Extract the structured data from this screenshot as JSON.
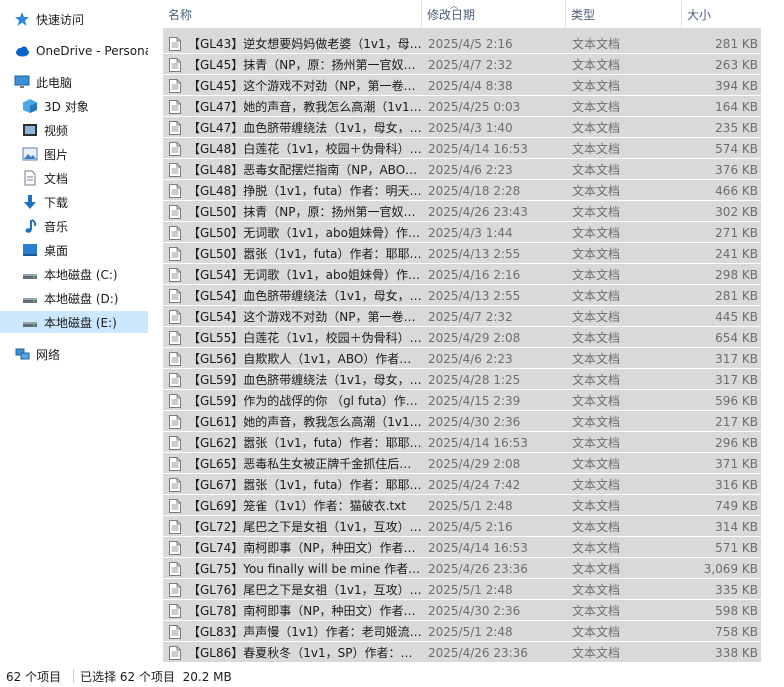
{
  "navigation": [
    {
      "label": "快速访问",
      "icon": "star-icon"
    },
    {
      "label": "OneDrive - Persona",
      "icon": "cloud-icon"
    },
    {
      "label": "此电脑",
      "icon": "computer-icon"
    },
    {
      "label": "3D 对象",
      "icon": "cube-icon"
    },
    {
      "label": "视频",
      "icon": "video-icon"
    },
    {
      "label": "图片",
      "icon": "picture-icon"
    },
    {
      "label": "文档",
      "icon": "document-icon"
    },
    {
      "label": "下载",
      "icon": "download-icon"
    },
    {
      "label": "音乐",
      "icon": "music-icon"
    },
    {
      "label": "桌面",
      "icon": "desktop-icon"
    },
    {
      "label": "本地磁盘 (C:)",
      "icon": "drive-icon"
    },
    {
      "label": "本地磁盘 (D:)",
      "icon": "drive-icon"
    },
    {
      "label": "本地磁盘 (E:)",
      "icon": "drive-icon",
      "selected": true
    },
    {
      "label": "网络",
      "icon": "network-icon"
    }
  ],
  "columns": {
    "name": "名称",
    "date": "修改日期",
    "type": "类型",
    "size": "大小"
  },
  "files": [
    {
      "name": "【GL43】逆女想要妈妈做老婆（1v1，母…",
      "date": "2025/4/5 2:16",
      "type": "文本文档",
      "size": "281 KB"
    },
    {
      "name": "【GL45】抹青（NP，原：扬州第一官奴…",
      "date": "2025/4/7 2:32",
      "type": "文本文档",
      "size": "263 KB"
    },
    {
      "name": "【GL45】这个游戏不对劲（NP，第一卷…",
      "date": "2025/4/4 8:38",
      "type": "文本文档",
      "size": "394 KB"
    },
    {
      "name": "【GL47】她的声音，教我怎么高潮（1v1…",
      "date": "2025/4/25 0:03",
      "type": "文本文档",
      "size": "164 KB"
    },
    {
      "name": "【GL47】血色脐带缠绕法（1v1，母女，…",
      "date": "2025/4/3 1:40",
      "type": "文本文档",
      "size": "235 KB"
    },
    {
      "name": "【GL48】白莲花（1v1，校园＋伪骨科）…",
      "date": "2025/4/14 16:53",
      "type": "文本文档",
      "size": "574 KB"
    },
    {
      "name": "【GL48】恶毒女配摆烂指南（NP，ABO…",
      "date": "2025/4/6 2:23",
      "type": "文本文档",
      "size": "376 KB"
    },
    {
      "name": "【GL48】挣脱（1v1，futa）作者：明天…",
      "date": "2025/4/18 2:28",
      "type": "文本文档",
      "size": "466 KB"
    },
    {
      "name": "【GL50】抹青（NP，原：扬州第一官奴…",
      "date": "2025/4/26 23:43",
      "type": "文本文档",
      "size": "302 KB"
    },
    {
      "name": "【GL50】无词歌（1v1，abo姐妹骨）作…",
      "date": "2025/4/3 1:44",
      "type": "文本文档",
      "size": "271 KB"
    },
    {
      "name": "【GL50】嚣张（1v1，futa）作者：耶耶…",
      "date": "2025/4/13 2:55",
      "type": "文本文档",
      "size": "241 KB"
    },
    {
      "name": "【GL54】无词歌（1v1，abo姐妹骨）作…",
      "date": "2025/4/16 2:16",
      "type": "文本文档",
      "size": "298 KB"
    },
    {
      "name": "【GL54】血色脐带缠绕法（1v1，母女，…",
      "date": "2025/4/13 2:55",
      "type": "文本文档",
      "size": "281 KB"
    },
    {
      "name": "【GL54】这个游戏不对劲（NP，第一卷…",
      "date": "2025/4/7 2:32",
      "type": "文本文档",
      "size": "445 KB"
    },
    {
      "name": "【GL55】白莲花（1v1，校园＋伪骨科）…",
      "date": "2025/4/29 2:08",
      "type": "文本文档",
      "size": "654 KB"
    },
    {
      "name": "【GL56】自欺欺人（1v1，ABO）作者…",
      "date": "2025/4/6 2:23",
      "type": "文本文档",
      "size": "317 KB"
    },
    {
      "name": "【GL59】血色脐带缠绕法（1v1，母女，…",
      "date": "2025/4/28 1:25",
      "type": "文本文档",
      "size": "317 KB"
    },
    {
      "name": "【GL59】作为的战俘的你 （gl futa）作…",
      "date": "2025/4/15 2:39",
      "type": "文本文档",
      "size": "596 KB"
    },
    {
      "name": "【GL61】她的声音，教我怎么高潮（1v1…",
      "date": "2025/4/30 2:36",
      "type": "文本文档",
      "size": "217 KB"
    },
    {
      "name": "【GL62】嚣张（1v1，futa）作者：耶耶…",
      "date": "2025/4/14 16:53",
      "type": "文本文档",
      "size": "296 KB"
    },
    {
      "name": "【GL65】恶毒私生女被正牌千金抓住后…",
      "date": "2025/4/29 2:08",
      "type": "文本文档",
      "size": "371 KB"
    },
    {
      "name": "【GL67】嚣张（1v1，futa）作者：耶耶…",
      "date": "2025/4/24 7:42",
      "type": "文本文档",
      "size": "316 KB"
    },
    {
      "name": "【GL69】笼雀（1v1）作者：猫破衣.txt",
      "date": "2025/5/1 2:48",
      "type": "文本文档",
      "size": "749 KB"
    },
    {
      "name": "【GL72】尾巴之下是女祖（1v1，互攻）…",
      "date": "2025/4/5 2:16",
      "type": "文本文档",
      "size": "314 KB"
    },
    {
      "name": "【GL74】南柯即事（NP，种田文）作者…",
      "date": "2025/4/14 16:53",
      "type": "文本文档",
      "size": "571 KB"
    },
    {
      "name": "【GL75】You finally will be mine 作者…",
      "date": "2025/4/26 23:36",
      "type": "文本文档",
      "size": "3,069 KB"
    },
    {
      "name": "【GL76】尾巴之下是女祖（1v1，互攻）…",
      "date": "2025/5/1 2:48",
      "type": "文本文档",
      "size": "335 KB"
    },
    {
      "name": "【GL78】南柯即事（NP，种田文）作者…",
      "date": "2025/4/30 2:36",
      "type": "文本文档",
      "size": "598 KB"
    },
    {
      "name": "【GL83】声声慢（1v1）作者：老司姬流…",
      "date": "2025/5/1 2:48",
      "type": "文本文档",
      "size": "758 KB"
    },
    {
      "name": "【GL86】春夏秋冬（1v1，SP）作者：…",
      "date": "2025/4/26 23:36",
      "type": "文本文档",
      "size": "338 KB"
    }
  ],
  "status": {
    "count": "62 个项目",
    "selected": "已选择 62 个项目  20.2 MB"
  },
  "colors": {
    "selected_row": "#d9d9d9",
    "nav_selected": "#cce8ff",
    "header_text": "#4c607a"
  }
}
